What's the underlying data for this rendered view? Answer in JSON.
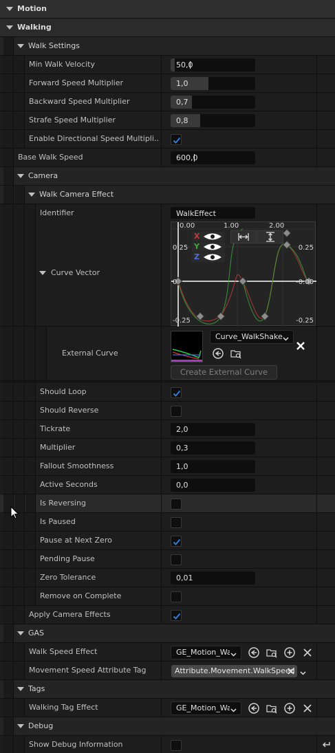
{
  "sections": {
    "motion": "Motion",
    "walking": "Walking",
    "walk_settings": "Walk Settings",
    "camera": "Camera",
    "walk_camera_effect": "Walk Camera Effect",
    "gas": "GAS",
    "tags": "Tags",
    "debug": "Debug"
  },
  "walk_settings": {
    "min_walk_velocity": {
      "label": "Min Walk Velocity",
      "value": "50,0",
      "fraction": 0.05
    },
    "forward_speed_multiplier": {
      "label": "Forward Speed Multiplier",
      "value": "1,0",
      "fraction": 0.45
    },
    "backward_speed_multiplier": {
      "label": "Backward Speed Multiplier",
      "value": "0,7",
      "fraction": 0.25
    },
    "strafe_speed_multiplier": {
      "label": "Strafe Speed Multiplier",
      "value": "0,8",
      "fraction": 0.35
    },
    "enable_directional": {
      "label": "Enable Directional Speed Multipli...",
      "checked": true
    }
  },
  "base_walk_speed": {
    "label": "Base Walk Speed",
    "value": "600,0"
  },
  "camera_effect": {
    "identifier": {
      "label": "Identifier",
      "value": "WalkEffect"
    },
    "curve_vector": {
      "label": "Curve Vector",
      "x_ticks": [
        "0.00",
        "1.00",
        "2.00"
      ],
      "y_ticks_left": [
        "0.25",
        "0",
        "-0.25"
      ],
      "y_ticks_right": [
        "0.25",
        "-0.00",
        "-0.25"
      ],
      "axes": [
        "X",
        "Y",
        "Z"
      ]
    },
    "external_curve": {
      "label": "External Curve",
      "asset": "Curve_WalkShake",
      "create_button": "Create External Curve"
    },
    "should_loop": {
      "label": "Should Loop",
      "checked": true
    },
    "should_reverse": {
      "label": "Should Reverse",
      "checked": false
    },
    "tickrate": {
      "label": "Tickrate",
      "value": "2,0"
    },
    "multiplier": {
      "label": "Multiplier",
      "value": "0,3"
    },
    "fallout_smoothness": {
      "label": "Fallout Smoothness",
      "value": "1,0"
    },
    "active_seconds": {
      "label": "Active Seconds",
      "value": "0,0"
    },
    "is_reversing": {
      "label": "Is Reversing",
      "checked": false
    },
    "is_paused": {
      "label": "Is Paused",
      "checked": false
    },
    "pause_at_next_zero": {
      "label": "Pause at Next Zero",
      "checked": true
    },
    "pending_pause": {
      "label": "Pending Pause",
      "checked": false
    },
    "zero_tolerance": {
      "label": "Zero Tolerance",
      "value": "0,01"
    },
    "remove_on_complete": {
      "label": "Remove on Complete",
      "checked": false
    }
  },
  "apply_camera_effects": {
    "label": "Apply Camera Effects",
    "checked": true
  },
  "gas": {
    "walk_speed_effect": {
      "label": "Walk Speed Effect",
      "value": "GE_Motion_Wa"
    },
    "movement_speed_tag": {
      "label": "Movement Speed Attribute Tag",
      "value": "Attribute.Movement.WalkSpeed"
    }
  },
  "tags": {
    "walking_tag_effect": {
      "label": "Walking Tag Effect",
      "value": "GE_Motion_Wa"
    }
  },
  "debug": {
    "show_debug": {
      "label": "Show Debug Information",
      "checked": false
    }
  },
  "colors": {
    "accent_check": "#2f7de1",
    "curve_x": "#c23a3a",
    "curve_y": "#3aa63a",
    "curve_z": "#4a6fe0"
  }
}
